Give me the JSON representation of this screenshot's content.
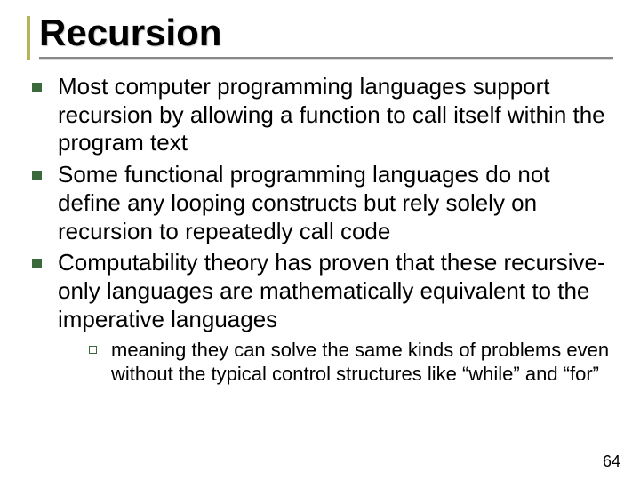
{
  "title": "Recursion",
  "bullets": [
    "Most computer programming languages support recursion by allowing a function to call itself within the program text",
    "Some functional programming languages do not define any looping constructs but rely solely on recursion to repeatedly call code",
    "Computability theory has proven that these recursive-only languages are mathematically equivalent to the imperative languages"
  ],
  "subbullets": [
    "meaning they can solve the same kinds of problems even without the typical control structures like “while” and “for”"
  ],
  "page_number": "64"
}
